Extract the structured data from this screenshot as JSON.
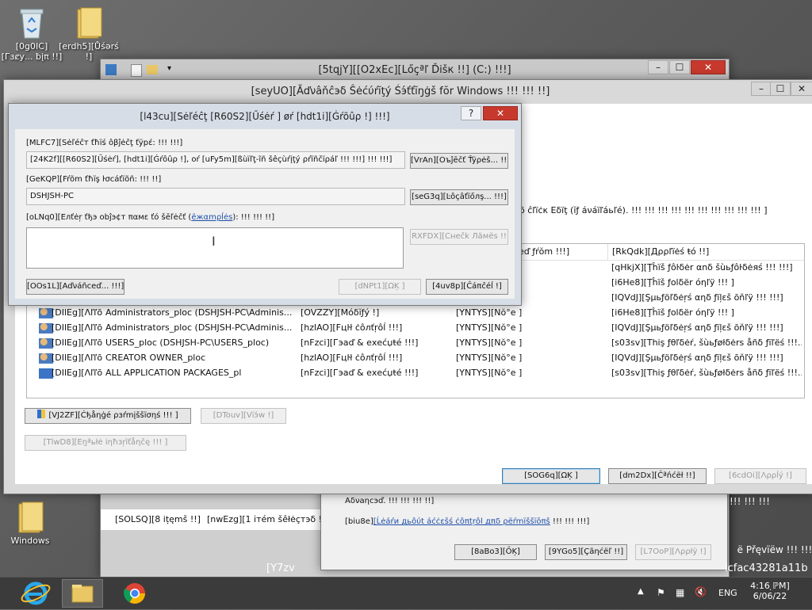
{
  "desktop": {
    "icons": [
      {
        "label": "[0g0IC][Гзȼу... ƀįπ !!]"
      },
      {
        "label": "[erdh5][Ůśərś !]"
      },
      {
        "label": "Windows"
      }
    ]
  },
  "explorer": {
    "title": "[5tqjY][[O2xEc][Lőçªľ Ďišк !!] (C:) !!!]",
    "status_items": "[SOLSQ][8 ițęmš !!]",
    "status_selected": "[nwEzg][1 ітém šêłėçтэδ !!]",
    "bottom_text": "[Y7zv",
    "bottom_hash": "lcfac43281a11b",
    "right_text": "!!! !!! !!!",
    "preview_text": "ë Přęvïëw !!! !!!]"
  },
  "props_dialog": {
    "text_advanced": "Аδνаηcэď. !!! !!! !!! !!]",
    "link_prefix": "[biu8e]",
    "link_text": "[Ĺėáŕи дьôύt áćċεšś ċôπtŗôl дπδ ρёŕmïššïōπš",
    "link_suffix": " !!! !!! !!!]",
    "ok": "[8aBo3][ŐĶ]",
    "cancel": "[9YGo5][Çãηćёľ !!]",
    "apply": "[L7OoP][Λρρłÿ !]"
  },
  "advanced": {
    "title": "[seyUO][Ăďνâňĉэδ Ŝėćύŕĭţý Śэ́ťťĭŋġš fŏr Windows !!! !!! !!]",
    "partial_instruction": "δ ĉľïċκ Eδïţ (ĭƒ áνáïľáьľé). !!! !!! !!! !!! !!! !!! !!! !!! !!! !!! ]",
    "columns": {
      "inherited": "ėď ƒŕŏm !!!]",
      "applies": "[RkQdk][Дρρľïėś ŧό !!]"
    },
    "rows": [
      {
        "type": "",
        "principal": "",
        "access": "",
        "inherited": "",
        "applies": "[qHkjX][Ţĥïš ƒôŀδėr αnδ šùьƒôŀδėяś !!! !!!]",
        "icon": "none"
      },
      {
        "type": "",
        "principal": "",
        "access": "",
        "inherited": "",
        "applies": "[i6He8][Ţĥïš ƒolδër óηľÿ !!! ]",
        "icon": "none"
      },
      {
        "type": "",
        "principal": "",
        "access": "",
        "inherited": "",
        "applies": "[IQVdJ][Şµьƒöľδėŗś αηδ ƒïļεš ōňľÿ !!! !!!]",
        "icon": "none"
      },
      {
        "type": "[DIlEg][Λľľōώ !!]",
        "principal": "Administrators_ploc (DSHJSH-PC\\Adminis...",
        "access": "[OVZZY][Mόδĭƒý !]",
        "inherited": "[YNTYS][Nŏ°e ]",
        "applies": "[i6He8][Ţĥïš ƒolδër óηľÿ !!! ]",
        "icon": "group"
      },
      {
        "type": "[DIlEg][Λľľōώ !!]",
        "principal": "Administrators_ploc (DSHJSH-PC\\Adminis...",
        "access": "[hzlAO][Fцŀł ċôлťŗôĺ !!!]",
        "inherited": "[YNTYS][Nŏ°e ]",
        "applies": "[IQVdJ][Şµьƒöľδėŗś αηδ ƒïļεš ōňľÿ !!! !!!]",
        "icon": "group"
      },
      {
        "type": "[DIlEg][Λľľōώ !!]",
        "principal": "USERS_ploc (DSHJSH-PC\\USERS_ploc)",
        "access": "[nFzci][Гэаď & ехеćџŧé !!!]",
        "inherited": "[YNTYS][Nŏ°e ]",
        "applies": "[s03sv][Thiş ƒθľδėŕ, šùьƒøłδėrs åñδ ƒïľëś !!!...",
        "icon": "group"
      },
      {
        "type": "[DIlEg][Λľľōώ !!]",
        "principal": "CREATOR OWNER_ploc",
        "access": "[hzlAO][Fцŀł ċôлťŗôĺ !!!]",
        "inherited": "[YNTYS][Nŏ°e ]",
        "applies": "[IQVdJ][Şµьƒöľδėŗś αηδ ƒïļεš ōňľÿ !!! !!!]",
        "icon": "group"
      },
      {
        "type": "[DIlEg][Λľľōώ !!]",
        "principal": "ALL APPLICATION PACKAGES_pl",
        "access": "[nFzci][Гэаď & ехеćџŧé !!!]",
        "inherited": "[YNTYS][Nŏ°e ]",
        "applies": "[s03sv][Thiş ƒθľδėŕ, šùьƒøłδėrs åñδ ƒïľëś !!!...",
        "icon": "package"
      }
    ],
    "change_permissions": "[VJ2ZF][Ćђåηġé ρзŕmįššïσηś !!! ]",
    "view": "[DTouv][Vïэ́w !]",
    "enable_inheritance": "[TlwD8][Eŋªьłė iηħзŗĭťåηčę !!! ]",
    "ok": "[SOG6q][ΩĶ ]",
    "cancel": "[dm2Dx][Ĉªńćёł !!]",
    "apply": "[6cdOi][Λρρĺý !]"
  },
  "select_dialog": {
    "title": "[l43cu][Sėľéĉţ [R60S2][Űśėŕ ] øŕ [hdt1i][Ġŕõûρ !] !!!]",
    "help": "?",
    "object_type_label": "[MLFC7][Sėľéĉт ťħïś ôβĵėčţ ťÿрέ: !!! !!!]",
    "object_type_value": "[24K2f][[R60S2][Űśėŕ], [hdt1i][Ġŕôûρ !], oŕ [uFy5m][ßùïľţ-ĩñ šêçùŕįţý ρŕïñčïρáľ !!! !!!] !!! !!!]",
    "object_types_btn": "[VrAn][Oъĵēčť Ťÿρėš... !!!]",
    "location_label": "[GeKQP][Fŕõm ťħïş ŀσсáťïõñ: !!! !!]",
    "location_value": "DSHJSH-PC",
    "locations_btn": "[seG3q][Ŀôçâťïőлş... !!!]",
    "names_label_pre": "[oLNq0][Eлťėŗ ťђэ оbĵэ¢т παмε ťó šēľėčť (",
    "names_label_link": "ĕжαmρĺėѕ",
    "names_label_post": "): !!! !!! !!]",
    "check_names": "RXFDX][Cнеčk Лăмёѕ !!",
    "advanced": "[OOs1L][Aďνáñсеď... !!!]",
    "ok": "[dNPt1][ΩĶ ]",
    "cancel": "[4uv8p][Ĉáπĉéĺ !]"
  },
  "taskbar": {
    "lang": "ENG",
    "time": "4:16 ̣ℙM]",
    "date": "6/06/22"
  }
}
